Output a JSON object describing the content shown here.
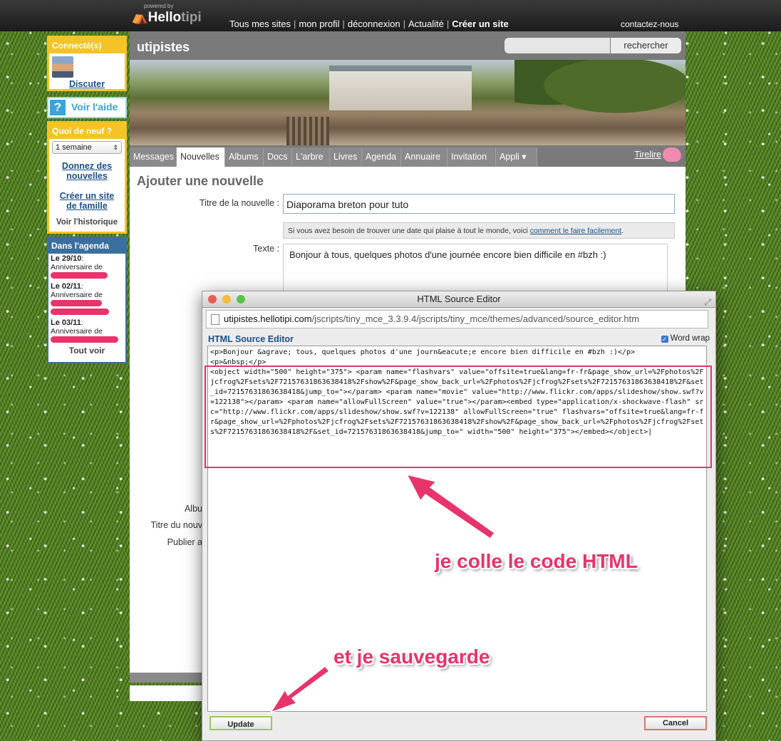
{
  "header": {
    "powered_by": "powered by",
    "logo_hello": "Hello",
    "logo_tipi": "tipi",
    "nav": [
      "Tous mes sites",
      "mon profil",
      "déconnexion",
      "Actualité",
      "Créer un site"
    ],
    "contact": "contactez-nous"
  },
  "sidebar": {
    "connected_title": "Connecté(s)",
    "chat_link": "Discuter",
    "help_icon": "?",
    "help_label": "Voir l'aide",
    "news_title": "Quoi de neuf ?",
    "period_select": "1 semaine",
    "give_news": "Donnez des nouvelles",
    "create_site": "Créer un site de famille",
    "history": "Voir l'historique",
    "agenda_title": "Dans l'agenda",
    "agenda": [
      {
        "date": "Le 29/10",
        "event": "Anniversaire de"
      },
      {
        "date": "Le 02/11",
        "event": "Anniversaire de"
      },
      {
        "date": "Le 03/11",
        "event": "Anniversaire de"
      }
    ],
    "see_all": "Tout voir"
  },
  "site": {
    "name": "utipistes",
    "search_button": "rechercher",
    "tabs": [
      "Messages",
      "Nouvelles",
      "Albums",
      "Docs",
      "L'arbre",
      "Livres",
      "Agenda",
      "Annuaire",
      "Invitation",
      "Appli"
    ],
    "active_tab": "Nouvelles",
    "tirelire": "Tirelire"
  },
  "form": {
    "page_title": "Ajouter une nouvelle",
    "title_label": "Titre de la nouvelle :",
    "title_value": "Diaporama breton pour tuto",
    "hint_text": "Si vous avez besoin de trouver une date qui plaise à tout le monde, voici",
    "hint_link": "comment le faire facilement",
    "text_label": "Texte :",
    "text_value": "Bonjour à tous, quelques photos d'une journée encore bien difficile en #bzh :)",
    "album_label": "Albu",
    "album_title_label": "Titre du nouv",
    "publish_label": "Publier a"
  },
  "modal": {
    "window_title": "HTML Source Editor",
    "url_host": "utipistes.hellotipi.com",
    "url_path": "/jscripts/tiny_mce_3.3.9.4/jscripts/tiny_mce/themes/advanced/source_editor.htm",
    "editor_heading": "HTML Source Editor",
    "word_wrap_label": "Word wrap",
    "word_wrap_checked": true,
    "source_code": "<p>Bonjour &agrave; tous, quelques photos d'une journ&eacute;e encore bien difficile en #bzh :)</p>\n<p>&nbsp;</p>\n<object width=\"500\" height=\"375\"> <param name=\"flashvars\" value=\"offsite=true&lang=fr-fr&page_show_url=%2Fphotos%2Fjcfrog%2Fsets%2F72157631863638418%2Fshow%2F&page_show_back_url=%2Fphotos%2Fjcfrog%2Fsets%2F72157631863638418%2F&set_id=72157631863638418&jump_to=\"></param> <param name=\"movie\" value=\"http://www.flickr.com/apps/slideshow/show.swf?v=122138\"></param> <param name=\"allowFullScreen\" value=\"true\"></param><embed type=\"application/x-shockwave-flash\" src=\"http://www.flickr.com/apps/slideshow/show.swf?v=122138\" allowFullScreen=\"true\" flashvars=\"offsite=true&lang=fr-fr&page_show_url=%2Fphotos%2Fjcfrog%2Fsets%2F72157631863638418%2Fshow%2F&page_show_back_url=%2Fphotos%2Fjcfrog%2Fsets%2F72157631863638418%2F&set_id=72157631863638418&jump_to=\" width=\"500\" height=\"375\"></embed></object>",
    "update_button": "Update",
    "cancel_button": "Cancel"
  },
  "annotations": {
    "paste_note": "je colle le code HTML",
    "save_note": "et je sauvegarde"
  },
  "colors": {
    "annotation_pink": "#e8336b",
    "link_blue": "#1a4f8a",
    "sidebar_yellow": "#f4c326",
    "sidebar_blue": "#3a6fa0"
  }
}
